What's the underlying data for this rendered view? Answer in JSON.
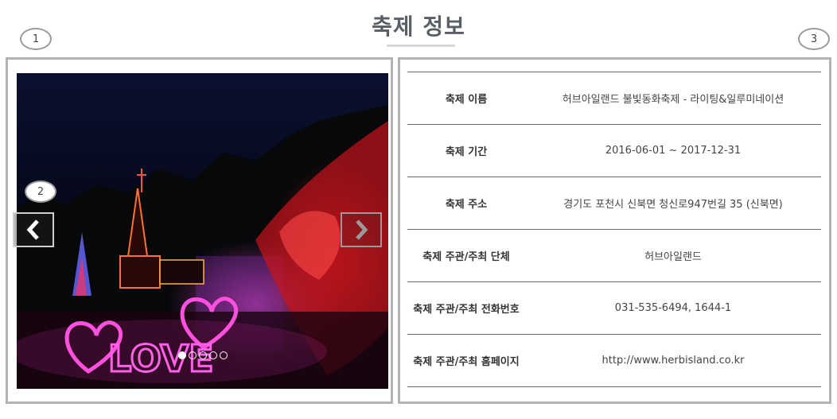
{
  "page": {
    "title": "축제 정보"
  },
  "badges": {
    "one": "1",
    "two": "2",
    "three": "3"
  },
  "slideshow": {
    "slide_text": "LOVE",
    "dot_count": 5,
    "active_dot": 0,
    "prev_icon": "chevron-left-icon",
    "next_icon": "chevron-right-icon"
  },
  "info": {
    "rows": [
      {
        "label": "축제 이름",
        "value": "허브아일랜드 불빛동화축제 - 라이팅&일루미네이션"
      },
      {
        "label": "축제 기간",
        "value": "2016-06-01 ~ 2017-12-31"
      },
      {
        "label": "축제 주소",
        "value": "경기도 포천시 신북면 청신로947번길 35 (신북면)"
      },
      {
        "label": "축제 주관/주최 단체",
        "value": "허브아일랜드"
      },
      {
        "label": "축제 주관/주최 전화번호",
        "value": "031-535-6494, 1644-1"
      },
      {
        "label": "축제 주관/주최 홈페이지",
        "value": "http://www.herbisland.co.kr"
      }
    ]
  },
  "colors": {
    "border": "#b3b3b3",
    "title": "#5a5f66",
    "neon_pink": "#ff3fd0",
    "neon_red": "#ff2a2a"
  }
}
